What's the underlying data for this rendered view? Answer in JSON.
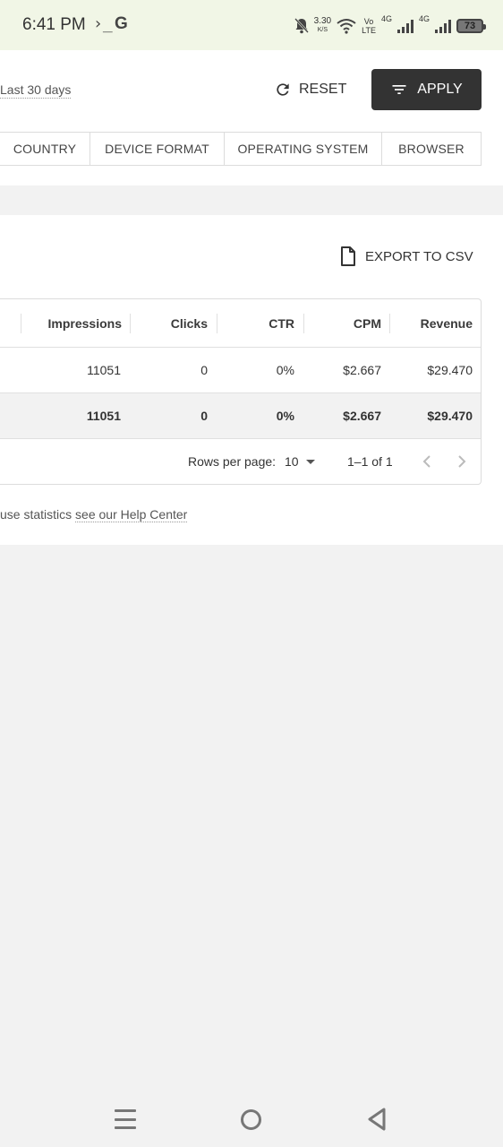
{
  "status_bar": {
    "time": "6:41 PM",
    "prompt_glyph": "›_",
    "g_glyph": "G",
    "speed_value": "3.30",
    "speed_unit": "K/S",
    "volte_top": "Vo",
    "volte_bottom": "LTE",
    "net1": "4G",
    "net2": "4G",
    "battery": "73",
    "icons": [
      "terminal-icon",
      "google-icon",
      "bell-off-icon",
      "wifi-icon",
      "signal-icon",
      "battery-icon"
    ]
  },
  "toolbar": {
    "date_range": "Last 30 days",
    "reset_label": "RESET",
    "apply_label": "APPLY"
  },
  "tabs": [
    {
      "label": "COUNTRY"
    },
    {
      "label": "DEVICE FORMAT"
    },
    {
      "label": "OPERATING SYSTEM"
    },
    {
      "label": "BROWSER"
    }
  ],
  "card": {
    "export_label": "EXPORT TO CSV",
    "help_prefix": "use statistics ",
    "help_link": "see our Help Center"
  },
  "table": {
    "columns": [
      "Impressions",
      "Clicks",
      "CTR",
      "CPM",
      "Revenue"
    ],
    "rows": [
      [
        "11051",
        "0",
        "0%",
        "$2.667",
        "$29.470"
      ]
    ],
    "total": [
      "11051",
      "0",
      "0%",
      "$2.667",
      "$29.470"
    ]
  },
  "pagination": {
    "rows_per_page_label": "Rows per page:",
    "rows_per_page_value": "10",
    "range": "1–1 of 1"
  },
  "colors": {
    "status_bar_bg": "#f1f6e6",
    "apply_bg": "#333333",
    "page_bg": "#f2f2f2"
  }
}
